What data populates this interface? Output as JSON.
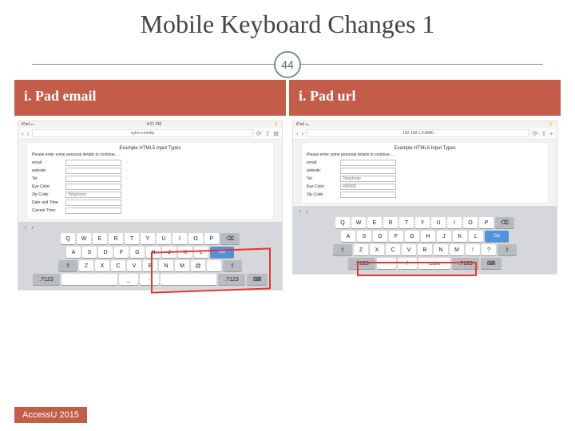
{
  "title": "Mobile Keyboard Changes 1",
  "page_number": "44",
  "footer": "AccessU 2015",
  "left": {
    "heading": "i. Pad email",
    "status": {
      "carrier": "iPad ⚏",
      "time": "4:01 PM",
      "batt": "⚡"
    },
    "nav": {
      "back": "‹",
      "fwd": "›",
      "addr": "nylon.com/kp",
      "reload": "⟳",
      "share": "⇪",
      "tabs": "⊞"
    },
    "form": {
      "title": "Example HTML5 Input Types",
      "note": "Please enter some personal details to continue…",
      "rows": [
        {
          "label": "email:",
          "val": ""
        },
        {
          "label": "website:",
          "val": ""
        },
        {
          "label": "Tel:",
          "val": ""
        },
        {
          "label": "Eye Color:",
          "val": ""
        },
        {
          "label": "Zip Code:",
          "val": "Telephone"
        },
        {
          "label": "Date and Time:",
          "val": ""
        },
        {
          "label": "Current Time:",
          "val": ""
        }
      ]
    },
    "keyboard": {
      "r1": [
        "Q",
        "W",
        "E",
        "R",
        "T",
        "Y",
        "U",
        "I",
        "O",
        "P"
      ],
      "r2": [
        "A",
        "S",
        "D",
        "F",
        "G",
        "H",
        "J",
        "K",
        "L"
      ],
      "go": "Go",
      "r3": [
        "Z",
        "X",
        "C",
        "V",
        "B",
        "N",
        "M",
        "@",
        "."
      ],
      "r4_left": ".?123",
      "r4_keys": [
        "",
        "_",
        "-",
        ""
      ],
      "r4_right": ".?123"
    }
  },
  "right": {
    "heading": "i. Pad url",
    "status": {
      "carrier": "iPad ⚏",
      "time": "",
      "batt": "⚡"
    },
    "nav": {
      "back": "‹",
      "fwd": "›",
      "addr": "192.168.1.9:8080",
      "reload": "⟳",
      "share": "⇪",
      "tabs": "+"
    },
    "form": {
      "title": "Example HTML5 Input Types",
      "note": "Please enter some personal details to continue…",
      "rows": [
        {
          "label": "email:",
          "val": ""
        },
        {
          "label": "website:",
          "val": ""
        },
        {
          "label": "Tel:",
          "val": "Telephone"
        },
        {
          "label": "Eye Color:",
          "val": "#00000"
        },
        {
          "label": "Zip Code:",
          "val": ""
        }
      ]
    },
    "keyboard": {
      "r1": [
        "Q",
        "W",
        "E",
        "R",
        "T",
        "Y",
        "U",
        "I",
        "O",
        "P"
      ],
      "r2": [
        "A",
        "S",
        "D",
        "F",
        "G",
        "H",
        "J",
        "K",
        "L"
      ],
      "go": "Go",
      "r3": [
        "Z",
        "X",
        "C",
        "V",
        "B",
        "N",
        "M",
        "!",
        "?"
      ],
      "r4_left": ".?123",
      "r4_keys": [
        ".",
        "/",
        ".com"
      ],
      "r4_right": ".?123"
    }
  }
}
